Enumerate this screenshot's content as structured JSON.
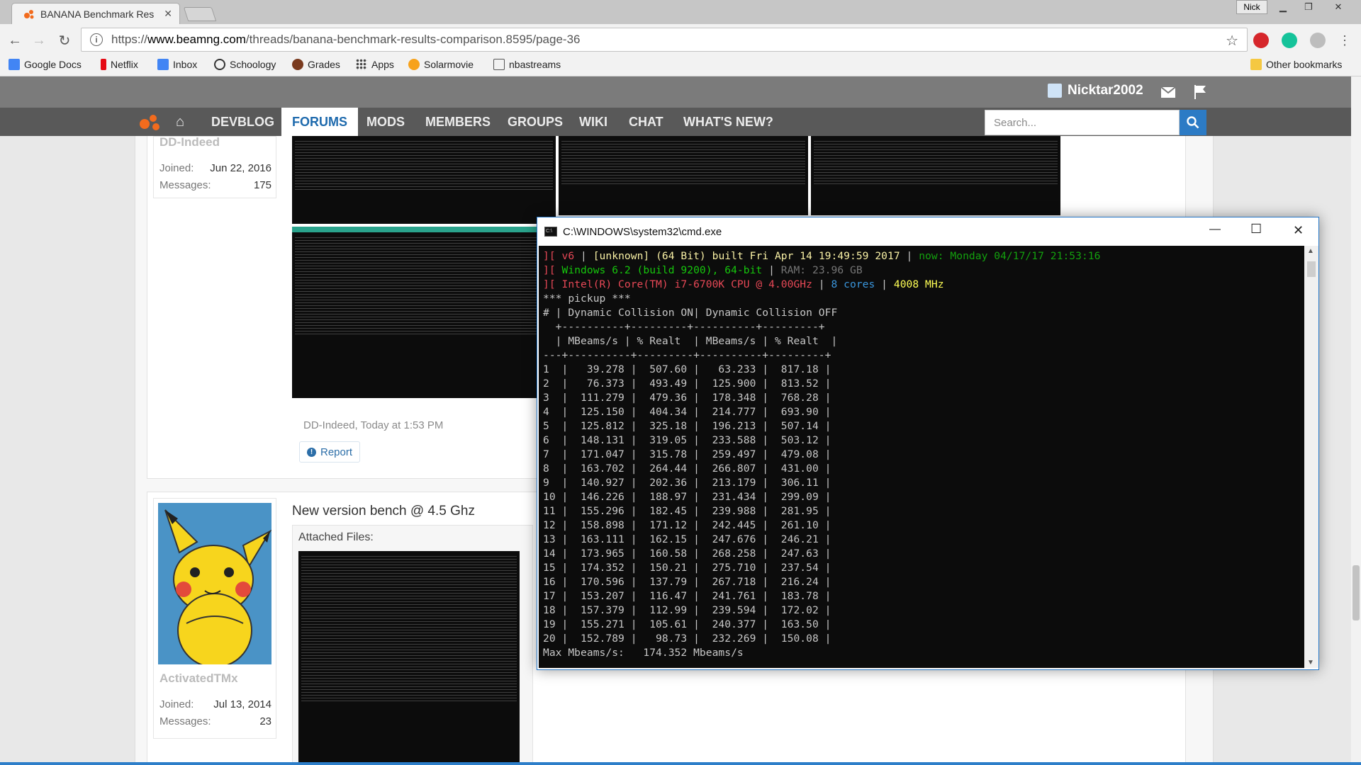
{
  "browser": {
    "tab_title": "BANANA Benchmark Res",
    "profile_name": "Nick",
    "url_prefix": "https://",
    "url_domain": "www.beamng.com",
    "url_path": "/threads/banana-benchmark-results-comparison.8595/page-36",
    "bookmarks": [
      "Google Docs",
      "Netflix",
      "Inbox",
      "Schoology",
      "Grades",
      "Apps",
      "Solarmovie",
      "nbastreams"
    ],
    "other_bookmarks": "Other bookmarks"
  },
  "site": {
    "username": "Nicktar2002",
    "nav": [
      "DEVBLOG",
      "FORUMS",
      "MODS",
      "MEMBERS",
      "GROUPS",
      "WIKI",
      "CHAT",
      "WHAT'S NEW?"
    ],
    "search_placeholder": "Search...",
    "accent": "#2c7bc5"
  },
  "post1": {
    "author": "DD-Indeed",
    "joined_label": "Joined:",
    "joined": "Jun 22, 2016",
    "messages_label": "Messages:",
    "messages": "175",
    "meta": "DD-Indeed, Today at 1:53 PM",
    "report": "Report"
  },
  "post2": {
    "title": "New version bench @ 4.5 Ghz",
    "attached_label": "Attached Files:",
    "author": "ActivatedTMx",
    "joined_label": "Joined:",
    "joined": "Jul 13, 2014",
    "messages_label": "Messages:",
    "messages": "23"
  },
  "cmd": {
    "title": "C:\\WINDOWS\\system32\\cmd.exe",
    "header": {
      "l1_version": "v6",
      "l1_build": "[unknown] (64 Bit) built Fri Apr 14 19:49:59 2017",
      "l1_now": "now: Monday 04/17/17 21:53:16",
      "l2_os": "Windows 6.2 (build 9200), 64-bit",
      "l2_ram": "RAM: 23.96 GB",
      "l3_cpu": "Intel(R) Core(TM) i7-6700K CPU @ 4.00GHz",
      "l3_cores": "8 cores",
      "l3_mhz": "4008 MHz"
    },
    "section": "*** pickup ***",
    "col_header": "# | Dynamic Collision ON| Dynamic Collision OFF",
    "separator": "  +----------+---------+----------+---------+",
    "subheader": "  | MBeams/s | % Realt  | MBeams/s | % Realt  |",
    "rule": "---+----------+---------+----------+---------+",
    "rows": [
      [
        "1",
        "39.278",
        "507.60",
        "63.233",
        "817.18"
      ],
      [
        "2",
        "76.373",
        "493.49",
        "125.900",
        "813.52"
      ],
      [
        "3",
        "111.279",
        "479.36",
        "178.348",
        "768.28"
      ],
      [
        "4",
        "125.150",
        "404.34",
        "214.777",
        "693.90"
      ],
      [
        "5",
        "125.812",
        "325.18",
        "196.213",
        "507.14"
      ],
      [
        "6",
        "148.131",
        "319.05",
        "233.588",
        "503.12"
      ],
      [
        "7",
        "171.047",
        "315.78",
        "259.497",
        "479.08"
      ],
      [
        "8",
        "163.702",
        "264.44",
        "266.807",
        "431.00"
      ],
      [
        "9",
        "140.927",
        "202.36",
        "213.179",
        "306.11"
      ],
      [
        "10",
        "146.226",
        "188.97",
        "231.434",
        "299.09"
      ],
      [
        "11",
        "155.296",
        "182.45",
        "239.988",
        "281.95"
      ],
      [
        "12",
        "158.898",
        "171.12",
        "242.445",
        "261.10"
      ],
      [
        "13",
        "163.111",
        "162.15",
        "247.676",
        "246.21"
      ],
      [
        "14",
        "173.965",
        "160.58",
        "268.258",
        "247.63"
      ],
      [
        "15",
        "174.352",
        "150.21",
        "275.710",
        "237.54"
      ],
      [
        "16",
        "170.596",
        "137.79",
        "267.718",
        "216.24"
      ],
      [
        "17",
        "153.207",
        "116.47",
        "241.761",
        "183.78"
      ],
      [
        "18",
        "157.379",
        "112.99",
        "239.594",
        "172.02"
      ],
      [
        "19",
        "155.271",
        "105.61",
        "240.377",
        "163.50"
      ],
      [
        "20",
        "152.789",
        "98.73",
        "232.269",
        "150.08"
      ]
    ],
    "footer": "Max Mbeams/s:   174.352 Mbeams/s"
  }
}
